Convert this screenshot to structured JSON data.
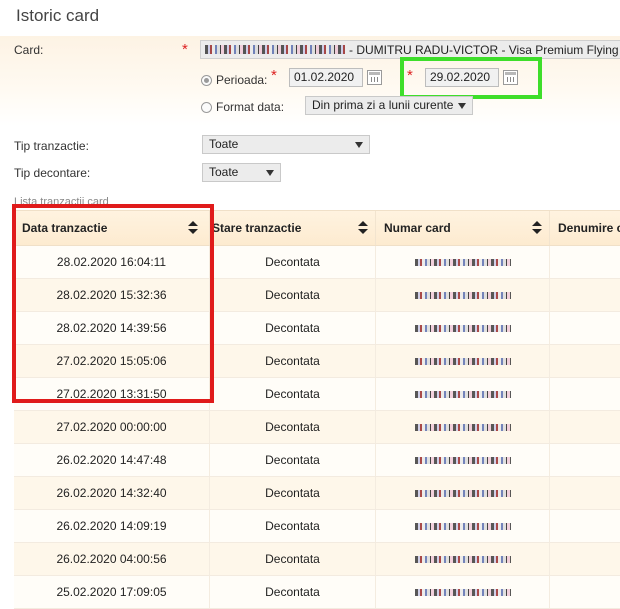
{
  "page": {
    "title": "Istoric card"
  },
  "form": {
    "card_label": "Card:",
    "card_value": "- DUMITRU RADU-VICTOR - Visa Premium Flying B",
    "perioada_label": "Perioada:",
    "date_from": "01.02.2020",
    "date_to": "29.02.2020",
    "format_data_label": "Format data:",
    "format_data_value": "Din prima zi a lunii curente",
    "tip_tranzactie_label": "Tip tranzactie:",
    "tip_tranzactie_value": "Toate",
    "tip_decontare_label": "Tip decontare:",
    "tip_decontare_value": "Toate",
    "required_mark": "*"
  },
  "grid": {
    "title": "Lista tranzactii card",
    "columns": [
      "Data tranzactie",
      "Stare tranzactie",
      "Numar card",
      "Denumire c"
    ],
    "rows": [
      {
        "date": "28.02.2020 16:04:11",
        "status": "Decontata"
      },
      {
        "date": "28.02.2020 15:32:36",
        "status": "Decontata"
      },
      {
        "date": "28.02.2020 14:39:56",
        "status": "Decontata"
      },
      {
        "date": "27.02.2020 15:05:06",
        "status": "Decontata"
      },
      {
        "date": "27.02.2020 13:31:50",
        "status": "Decontata"
      },
      {
        "date": "27.02.2020 00:00:00",
        "status": "Decontata"
      },
      {
        "date": "26.02.2020 14:47:48",
        "status": "Decontata"
      },
      {
        "date": "26.02.2020 14:32:40",
        "status": "Decontata"
      },
      {
        "date": "26.02.2020 14:09:19",
        "status": "Decontata"
      },
      {
        "date": "26.02.2020 04:00:56",
        "status": "Decontata"
      },
      {
        "date": "25.02.2020 17:09:05",
        "status": "Decontata"
      }
    ]
  },
  "annotations": {
    "red": "#e01b1b",
    "green": "#3ede2a"
  }
}
